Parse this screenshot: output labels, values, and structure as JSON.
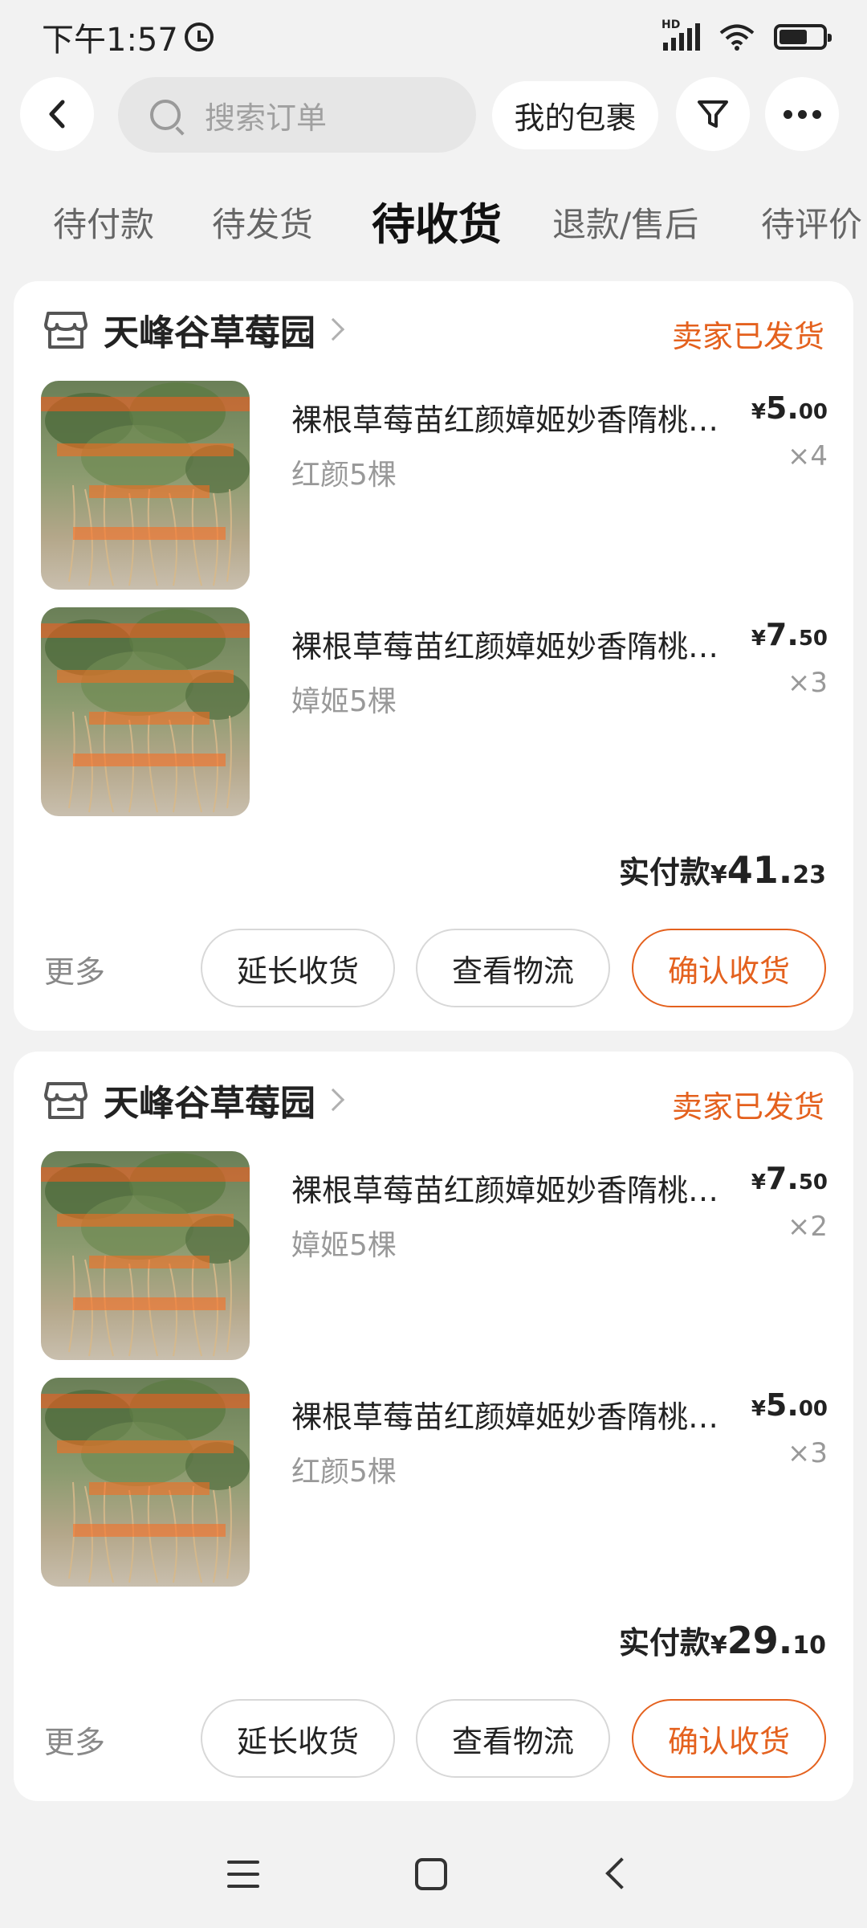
{
  "status_bar": {
    "time": "下午1:57",
    "network": "HD"
  },
  "header": {
    "search_placeholder": "搜索订单",
    "parcels_label": "我的包裹"
  },
  "tabs": [
    {
      "label": "待付款"
    },
    {
      "label": "待发货"
    },
    {
      "label": "待收货",
      "active": true
    },
    {
      "label": "退款/售后"
    },
    {
      "label": "待评价"
    }
  ],
  "orders": [
    {
      "shop_name": "天峰谷草莓园",
      "status": "卖家已发货",
      "items": [
        {
          "title": "裸根草莓苗红颜嫜姬妙香隋桃露大苗",
          "spec": "红颜5棵",
          "currency": "¥",
          "price_int": "5.",
          "price_dec": "00",
          "qty": "×4"
        },
        {
          "title": "裸根草莓苗红颜嫜姬妙香隋桃露大苗",
          "spec": "嫜姬5棵",
          "currency": "¥",
          "price_int": "7.",
          "price_dec": "50",
          "qty": "×3"
        }
      ],
      "paid_label": "实付款",
      "paid_currency": "¥",
      "paid_int": "41.",
      "paid_dec": "23",
      "more_label": "更多",
      "buttons": {
        "extend": "延长收货",
        "logistics": "查看物流",
        "confirm": "确认收货"
      }
    },
    {
      "shop_name": "天峰谷草莓园",
      "status": "卖家已发货",
      "items": [
        {
          "title": "裸根草莓苗红颜嫜姬妙香隋桃露大苗",
          "spec": "嫜姬5棵",
          "currency": "¥",
          "price_int": "7.",
          "price_dec": "50",
          "qty": "×2"
        },
        {
          "title": "裸根草莓苗红颜嫜姬妙香隋桃露大苗",
          "spec": "红颜5棵",
          "currency": "¥",
          "price_int": "5.",
          "price_dec": "00",
          "qty": "×3"
        }
      ],
      "paid_label": "实付款",
      "paid_currency": "¥",
      "paid_int": "29.",
      "paid_dec": "10",
      "more_label": "更多",
      "buttons": {
        "extend": "延长收货",
        "logistics": "查看物流",
        "confirm": "确认收货"
      }
    }
  ],
  "colors": {
    "accent": "#e4611e",
    "background": "#f2f2f2",
    "card": "#ffffff"
  }
}
